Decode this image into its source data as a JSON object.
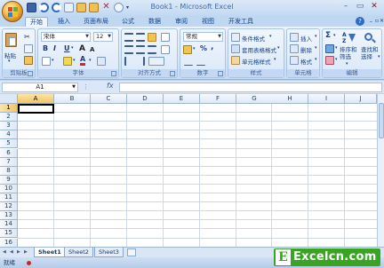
{
  "window": {
    "title": "Book1 - Microsoft Excel"
  },
  "ribbon_tabs": [
    "开始",
    "插入",
    "页面布局",
    "公式",
    "数据",
    "审阅",
    "视图",
    "开发工具"
  ],
  "clipboard": {
    "paste_label": "粘贴",
    "group_label": "剪贴板"
  },
  "font": {
    "name": "宋体",
    "size": "12",
    "bold": "B",
    "italic": "I",
    "underline": "U",
    "font_color_letter": "A",
    "group_label": "字体"
  },
  "alignment": {
    "group_label": "对齐方式"
  },
  "number": {
    "format": "常规",
    "percent": "%",
    "comma": ",",
    "currency_symbol": "",
    "group_label": "数字"
  },
  "styles": {
    "conditional": "条件格式",
    "table": "套用表格格式",
    "cell": "单元格样式",
    "group_label": "样式"
  },
  "cells": {
    "insert": "插入",
    "delete": "删除",
    "format": "格式",
    "group_label": "单元格"
  },
  "editing": {
    "sort_filter": "排序和\n筛选",
    "find_select": "查找和\n选择",
    "sort_line1": "排序和",
    "sort_line2": "筛选",
    "find_line1": "查找和",
    "find_line2": "选择",
    "group_label": "编辑",
    "sigma": "Σ"
  },
  "formula_bar": {
    "name_box": "A1",
    "fx": "fx",
    "value": ""
  },
  "columns": [
    "A",
    "B",
    "C",
    "D",
    "E",
    "F",
    "G",
    "H",
    "I",
    "J"
  ],
  "rows": [
    "1",
    "2",
    "3",
    "4",
    "5",
    "6",
    "7",
    "8",
    "9",
    "10",
    "11",
    "12",
    "13",
    "14",
    "15",
    "16"
  ],
  "sheets": [
    "Sheet1",
    "Sheet2",
    "Sheet3"
  ],
  "status": {
    "text": "就绪"
  },
  "watermark": {
    "letter": "E",
    "text": "Excelcn.com"
  }
}
